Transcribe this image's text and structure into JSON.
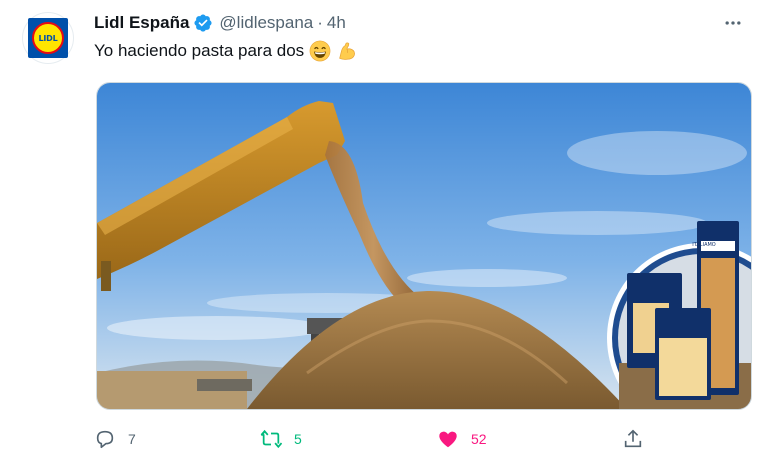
{
  "account": {
    "display_name": "Lidl España",
    "handle": "@lidlespana",
    "separator": "·",
    "time": "4h",
    "avatar_text": "LIDL",
    "verified_icon": "verified-badge-icon"
  },
  "tweet": {
    "text": "Yo haciendo pasta para dos",
    "emojis": [
      "grinning-face-icon",
      "flexed-biceps-icon"
    ]
  },
  "media": {
    "products": [
      {
        "brand": "ITALIAMO",
        "name": "Spaghetti Tricolore"
      },
      {
        "brand": "ITALIAMO",
        "name": "Tagliatelle"
      },
      {
        "brand": "ITALIAMO",
        "name": "Farfalle"
      }
    ]
  },
  "stats": {
    "replies": "7",
    "retweets": "5",
    "likes": "52"
  },
  "colors": {
    "retweet": "#00ba7c",
    "like": "#f91880",
    "verified": "#1d9bf0",
    "muted": "#536471"
  }
}
